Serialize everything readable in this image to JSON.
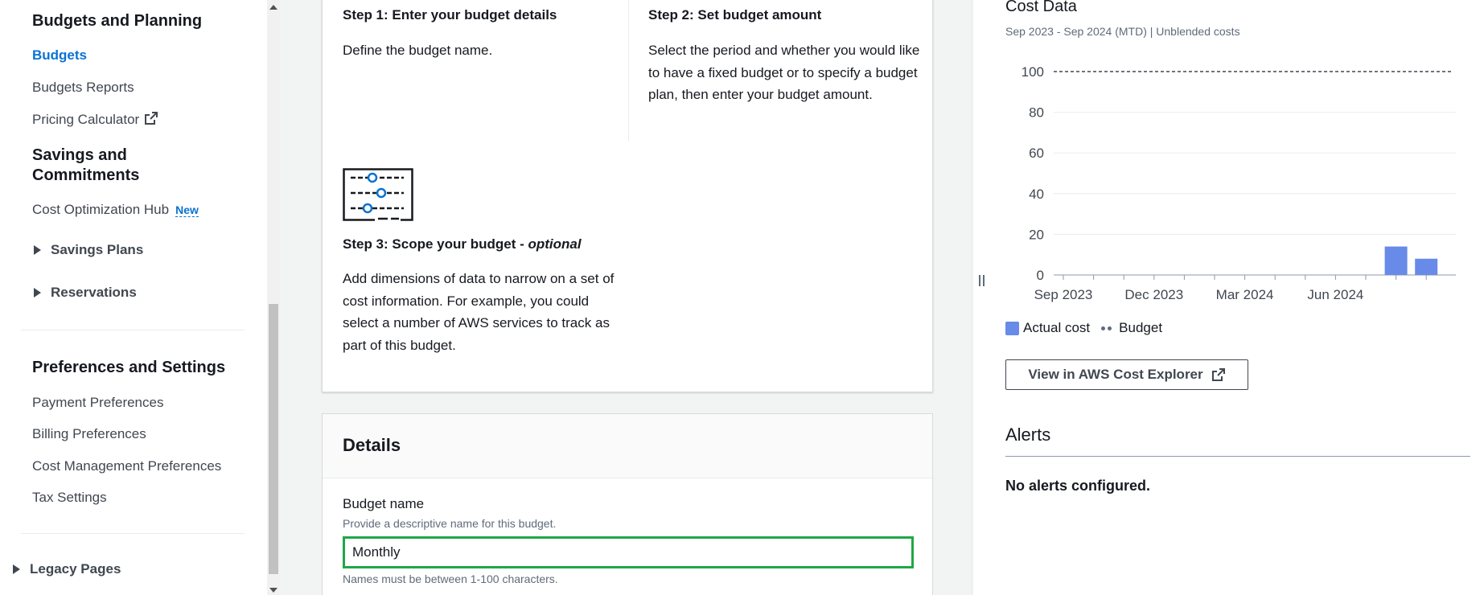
{
  "sidebar": {
    "section_budgets": "Budgets and Planning",
    "link_budgets": "Budgets",
    "link_reports": "Budgets Reports",
    "link_calculator": "Pricing Calculator",
    "section_savings": "Savings and Commitments",
    "link_hub": "Cost Optimization Hub",
    "badge_new": "New",
    "link_savings_plans": "Savings Plans",
    "link_reservations": "Reservations",
    "section_prefs": "Preferences and Settings",
    "link_payment": "Payment Preferences",
    "link_billing": "Billing Preferences",
    "link_costmgmt": "Cost Management Preferences",
    "link_tax": "Tax Settings",
    "link_legacy": "Legacy Pages"
  },
  "steps": {
    "step1_title": "Step 1: Enter your budget details",
    "step1_text": "Define the budget name.",
    "step2_title": "Step 2: Set budget amount",
    "step2_text": "Select the period and whether you would like to have a fixed budget or to specify a budget plan, then enter your budget amount.",
    "step3_title": "Step 3: Scope your budget - ",
    "step3_optional": "optional",
    "step3_text": "Add dimensions of data to narrow on a set of cost information. For example, you could select a number of AWS services to track as part of this budget."
  },
  "details": {
    "title": "Details",
    "budget_name_label": "Budget name",
    "budget_name_desc": "Provide a descriptive name for this budget.",
    "budget_name_value": "Monthly",
    "budget_name_hint": "Names must be between 1-100 characters."
  },
  "cost_panel": {
    "title": "Cost Data",
    "subtitle": "Sep 2023 - Sep 2024 (MTD) | Unblended costs",
    "legend_actual": "Actual cost",
    "legend_budget": "Budget",
    "explorer_button": "View in AWS Cost Explorer",
    "alerts_title": "Alerts",
    "alerts_empty": "No alerts configured.",
    "colors": {
      "actual": "#688ae8",
      "budget_line": "#414750"
    }
  },
  "chart_data": {
    "type": "bar",
    "x_tick_labels": [
      "Sep 2023",
      "Dec 2023",
      "Mar 2024",
      "Jun 2024"
    ],
    "y_ticks": [
      0,
      20,
      40,
      60,
      80,
      100
    ],
    "ylim": [
      0,
      100
    ],
    "series": [
      {
        "name": "Actual cost",
        "type": "bar",
        "x": [
          "Aug 2024",
          "Sep 2024"
        ],
        "values": [
          14,
          8
        ]
      },
      {
        "name": "Budget",
        "type": "line",
        "style": "dashed",
        "value": 100
      }
    ],
    "grid": true,
    "legend": "bottom-left"
  }
}
